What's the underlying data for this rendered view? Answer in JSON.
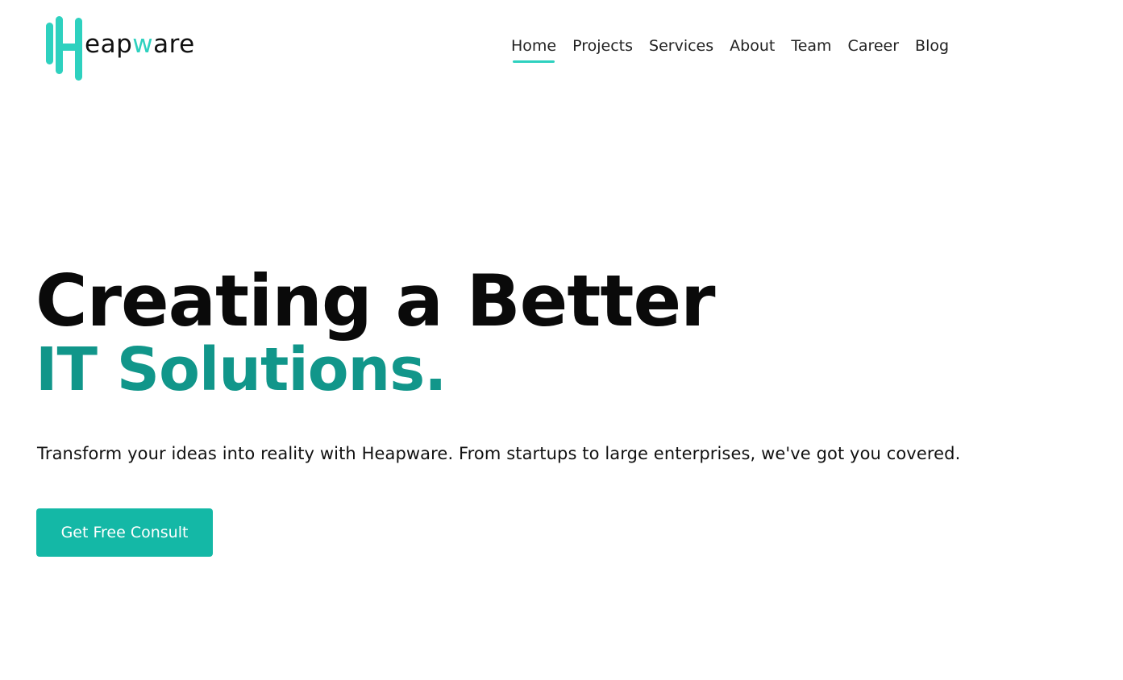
{
  "brand": {
    "name_prefix": "eap",
    "name_accent": "w",
    "name_suffix": "are",
    "logo_letter": "H",
    "accent_color": "#2ed1bf"
  },
  "nav": {
    "items": [
      {
        "label": "Home",
        "active": true
      },
      {
        "label": "Projects",
        "active": false
      },
      {
        "label": "Services",
        "active": false
      },
      {
        "label": "About",
        "active": false
      },
      {
        "label": "Team",
        "active": false
      },
      {
        "label": "Career",
        "active": false
      },
      {
        "label": "Blog",
        "active": false
      }
    ]
  },
  "hero": {
    "title_line1": "Creating a Better",
    "title_line2": "IT Solutions.",
    "title_line2_color": "#11968a",
    "subtitle": "Transform your ideas into reality with Heapware. From startups to large enterprises, we've got you covered.",
    "cta_label": "Get Free Consult",
    "cta_color": "#14b8a6"
  }
}
